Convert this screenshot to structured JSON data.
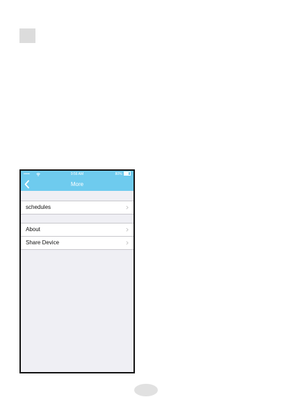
{
  "status_bar": {
    "signal": "•••••",
    "time": "9:56 AM",
    "battery_percent": "80%",
    "battery_level": 0.8
  },
  "nav": {
    "title": "More",
    "back_icon": "chevron-left-icon"
  },
  "menu": {
    "schedules": "schedules",
    "about": "About",
    "share_device": "Share Device",
    "row_icon": "chevron-right-icon"
  },
  "colors": {
    "nav_background": "#6ecbee",
    "list_background": "#efeff4",
    "separator": "#c8c7cc"
  }
}
